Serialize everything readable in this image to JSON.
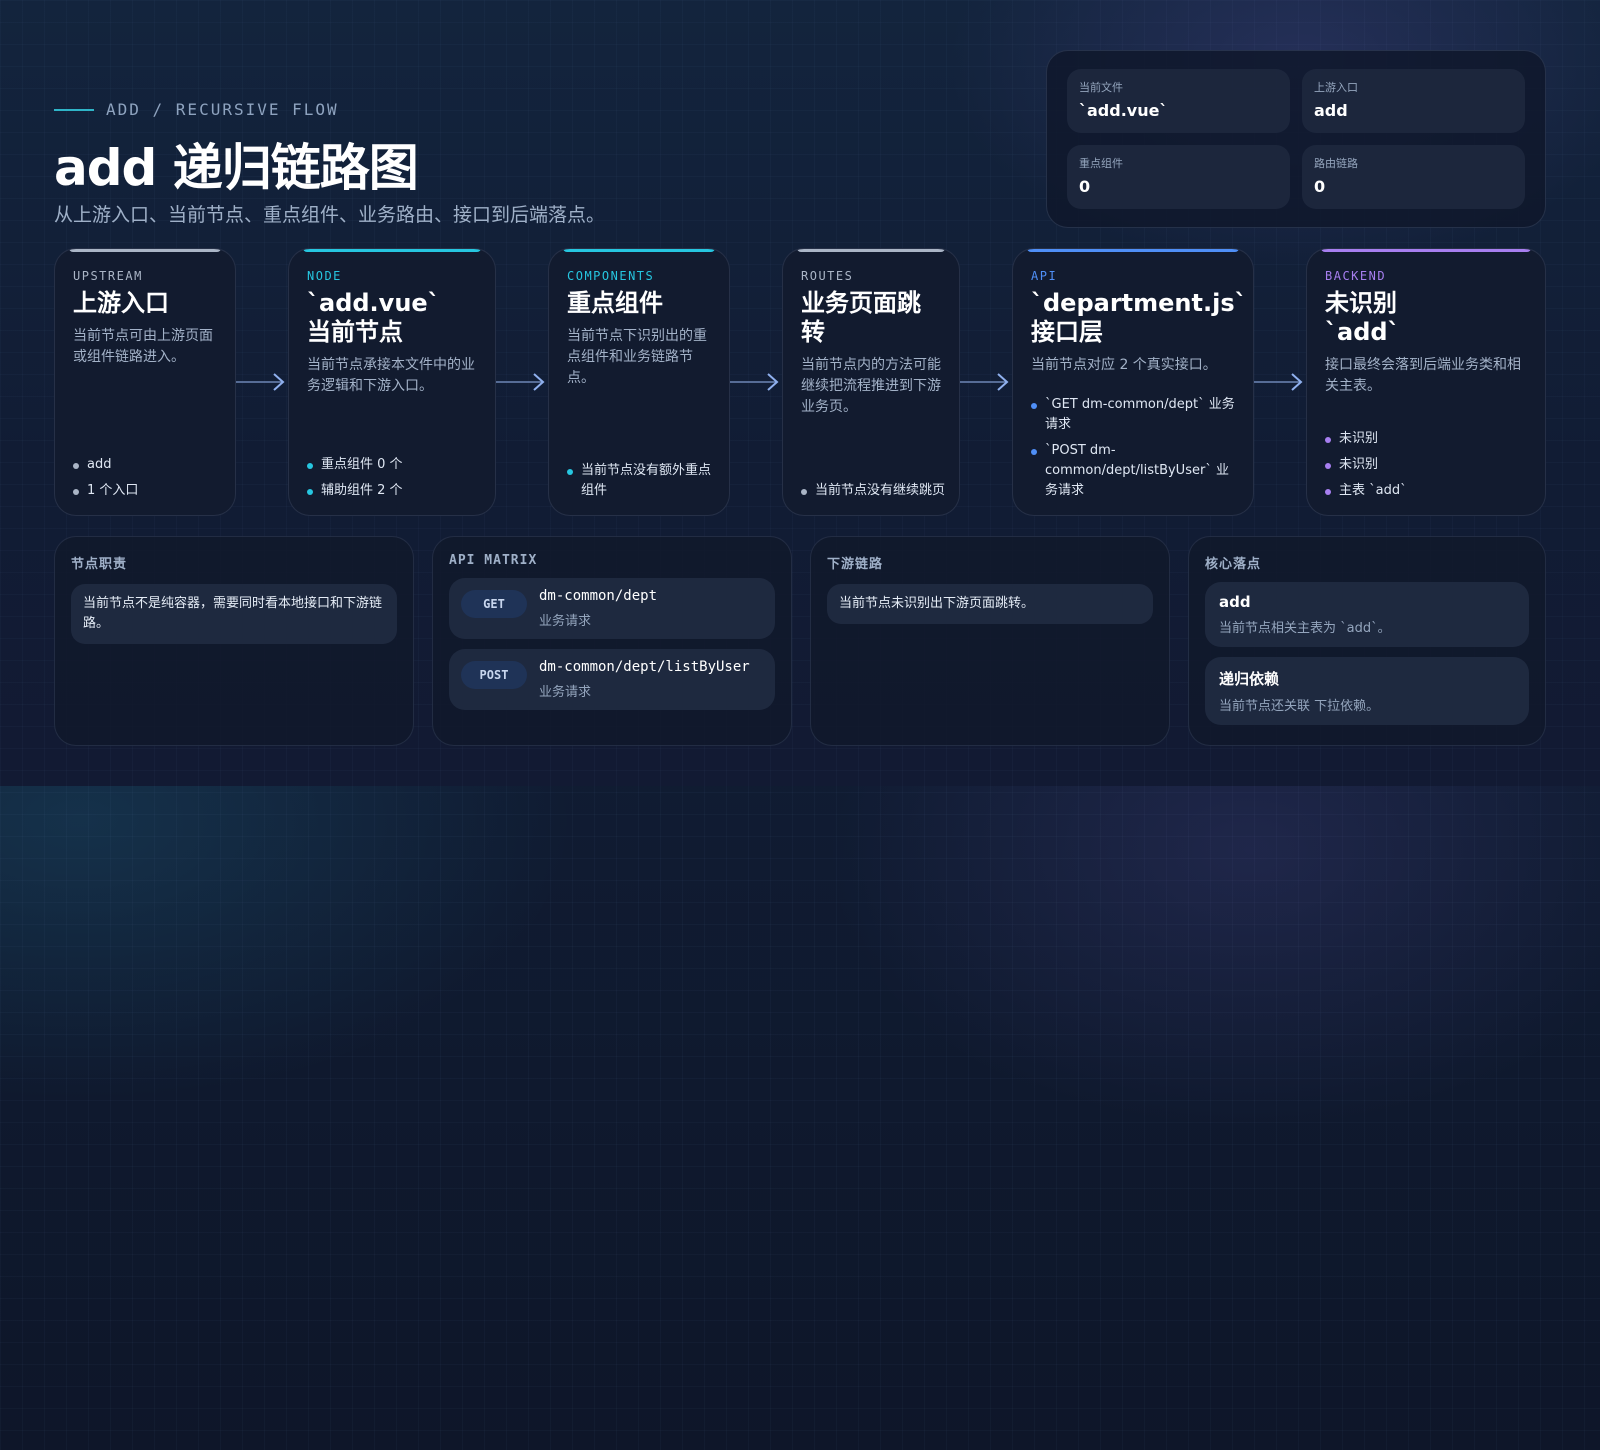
{
  "header": {
    "eyebrow": "ADD / RECURSIVE FLOW",
    "title": "add 递归链路图",
    "subtitle": "从上游入口、当前节点、重点组件、业务路由、接口到后端落点。"
  },
  "summary": [
    {
      "key": "当前文件",
      "value": "`add.vue`"
    },
    {
      "key": "上游入口",
      "value": "add"
    },
    {
      "key": "重点组件",
      "value": "0"
    },
    {
      "key": "路由链路",
      "value": "0"
    }
  ],
  "flow": [
    {
      "tag": "UPSTREAM",
      "title": "上游入口",
      "desc": "当前节点可由上游页面或组件链路进入。",
      "items": [
        "add",
        "1 个入口"
      ],
      "color": "#aab5c6"
    },
    {
      "tag": "NODE",
      "title": "`add.vue`\n当前节点",
      "desc": "当前节点承接本文件中的业务逻辑和下游入口。",
      "items": [
        "重点组件 0 个",
        "辅助组件 2 个"
      ],
      "color": "#26c6e0"
    },
    {
      "tag": "COMPONENTS",
      "title": "重点组件",
      "desc": "当前节点下识别出的重点组件和业务链路节点。",
      "items": [
        "当前节点没有额外重点组件"
      ],
      "color": "#26c6e0"
    },
    {
      "tag": "ROUTES",
      "title": "业务页面跳转",
      "desc": "当前节点内的方法可能继续把流程推进到下游业务页。",
      "items": [
        "当前节点没有继续跳页"
      ],
      "color": "#aab5c6"
    },
    {
      "tag": "API",
      "title": "`department.js`\n接口层",
      "desc": "当前节点对应 2 个真实接口。",
      "items": [
        "`GET dm-common/dept` 业务请求",
        "`POST dm-common/dept/listByUser` 业务请求"
      ],
      "color": "#4f8ff7"
    },
    {
      "tag": "BACKEND",
      "title": "未识别\n`add`",
      "desc": "接口最终会落到后端业务类和相关主表。",
      "items": [
        "未识别",
        "未识别",
        "主表 `add`"
      ],
      "color": "#a77ff0"
    }
  ],
  "panels": {
    "duty": {
      "title": "节点职责",
      "text": "当前节点不是纯容器，需要同时看本地接口和下游链路。"
    },
    "api": {
      "title": "API MATRIX",
      "rows": [
        {
          "method": "GET",
          "path": "dm-common/dept",
          "note": "业务请求"
        },
        {
          "method": "POST",
          "path": "dm-common/dept/listByUser",
          "note": "业务请求"
        }
      ]
    },
    "downstream": {
      "title": "下游链路",
      "text": "当前节点未识别出下游页面跳转。"
    },
    "core": {
      "title": "核心落点",
      "items": [
        {
          "title": "add",
          "desc": "当前节点相关主表为 `add`。"
        },
        {
          "title": "递归依赖",
          "desc": "当前节点还关联 下拉依赖。"
        }
      ]
    }
  }
}
